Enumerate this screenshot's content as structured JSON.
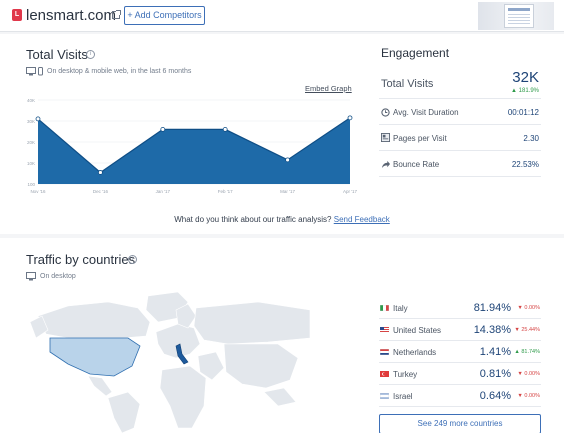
{
  "header": {
    "site_name": "lensmart.com",
    "favicon_text": "L",
    "add_competitors_label": "+ Add Competitors"
  },
  "traffic": {
    "title": "Total Visits",
    "info_glyph": "i",
    "subtitle": "On desktop & mobile web, in the last 6 months",
    "embed_label": "Embed Graph",
    "feedback_text": "What do you think about our traffic analysis?",
    "feedback_link": "Send Feedback"
  },
  "chart_data": {
    "type": "area",
    "categories": [
      "Nov '16",
      "Dec '16",
      "Jan '17",
      "Feb '17",
      "Mar '17",
      "Apr '17"
    ],
    "values": [
      31000,
      5500,
      26000,
      26000,
      11500,
      31500
    ],
    "y_ticks": [
      "40K",
      "30K",
      "20K",
      "10K",
      "100"
    ],
    "ylim": [
      0,
      40000
    ],
    "grid": true,
    "colors": {
      "fill": "#1e6aa8",
      "line": "#0f4e86",
      "marker": "#ffffff"
    }
  },
  "engagement": {
    "title": "Engagement",
    "total_visits_label": "Total Visits",
    "total_visits_value": "32K",
    "total_visits_change": "181.9%",
    "rows": [
      {
        "icon": "clock-icon",
        "label": "Avg. Visit Duration",
        "value": "00:01:12"
      },
      {
        "icon": "pages-icon",
        "label": "Pages per Visit",
        "value": "2.30"
      },
      {
        "icon": "bounce-arrow-icon",
        "label": "Bounce Rate",
        "value": "22.53%"
      }
    ]
  },
  "countries": {
    "title": "Traffic by countries",
    "info_glyph": "i",
    "subtitle": "On desktop",
    "more_label": "See 249 more countries",
    "rows": [
      {
        "name": "Italy",
        "share": "81.94%",
        "change": "0.00%",
        "direction": "down",
        "flag": [
          "#2e9a4a",
          "#ffffff",
          "#d64545"
        ]
      },
      {
        "name": "United States",
        "share": "14.38%",
        "change": "25.44%",
        "direction": "down",
        "flag": [
          "#2a4a8c",
          "#ffffff",
          "#d64545"
        ]
      },
      {
        "name": "Netherlands",
        "share": "1.41%",
        "change": "81.74%",
        "direction": "up",
        "flag": [
          "#d64545",
          "#ffffff",
          "#2a4a8c"
        ]
      },
      {
        "name": "Turkey",
        "share": "0.81%",
        "change": "0.00%",
        "direction": "down",
        "flag": [
          "#e03a3a",
          "#e03a3a",
          "#e03a3a"
        ]
      },
      {
        "name": "Israel",
        "share": "0.64%",
        "change": "0.00%",
        "direction": "down",
        "flag": [
          "#ffffff",
          "#3d6fb7",
          "#ffffff"
        ]
      }
    ],
    "highlighted_regions": [
      "United States",
      "Italy"
    ]
  }
}
